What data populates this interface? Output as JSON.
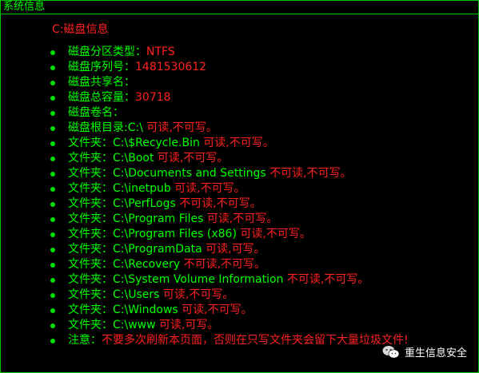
{
  "window": {
    "title": "系统信息"
  },
  "heading": "C:磁盘信息",
  "disk": [
    {
      "label": "磁盘分区类型：",
      "value": "NTFS"
    },
    {
      "label": "磁盘序列号：",
      "value": "1481530612"
    },
    {
      "label": "磁盘共享名：",
      "value": ""
    },
    {
      "label": "磁盘总容量：",
      "value": "30718"
    },
    {
      "label": "磁盘卷名：",
      "value": ""
    }
  ],
  "root": {
    "label": "磁盘根目录:C:\\ ",
    "perm": "可读,不可写。"
  },
  "folders": [
    {
      "label": "文件夹：C:\\$Recycle.Bin ",
      "perm": "可读,不可写。"
    },
    {
      "label": "文件夹：C:\\Boot ",
      "perm": "可读,不可写。"
    },
    {
      "label": "文件夹：C:\\Documents and Settings ",
      "perm": "不可读,不可写。"
    },
    {
      "label": "文件夹：C:\\inetpub ",
      "perm": "可读,不可写。"
    },
    {
      "label": "文件夹：C:\\PerfLogs ",
      "perm": "不可读,不可写。"
    },
    {
      "label": "文件夹：C:\\Program Files ",
      "perm": "可读,不可写。"
    },
    {
      "label": "文件夹：C:\\Program Files (x86) ",
      "perm": "可读,不可写。"
    },
    {
      "label": "文件夹：C:\\ProgramData ",
      "perm": "可读,可写。"
    },
    {
      "label": "文件夹：C:\\Recovery ",
      "perm": "不可读,不可写。"
    },
    {
      "label": "文件夹：C:\\System Volume Information ",
      "perm": "不可读,不可写。"
    },
    {
      "label": "文件夹：C:\\Users ",
      "perm": "可读,不可写。"
    },
    {
      "label": "文件夹：C:\\Windows ",
      "perm": "可读,不可写。"
    },
    {
      "label": "文件夹：C:\\www ",
      "perm": "可读,可写。"
    }
  ],
  "note": {
    "label": "注意：",
    "text": "不要多次刷新本页面，否则在只写文件夹会留下大量垃圾文件!"
  },
  "watermark": {
    "text": "重生信息安全",
    "icon": "wechat-icon"
  },
  "colors": {
    "label": "#00ff00",
    "value": "#ff2020",
    "border": "#00c800",
    "background": "#000000"
  }
}
